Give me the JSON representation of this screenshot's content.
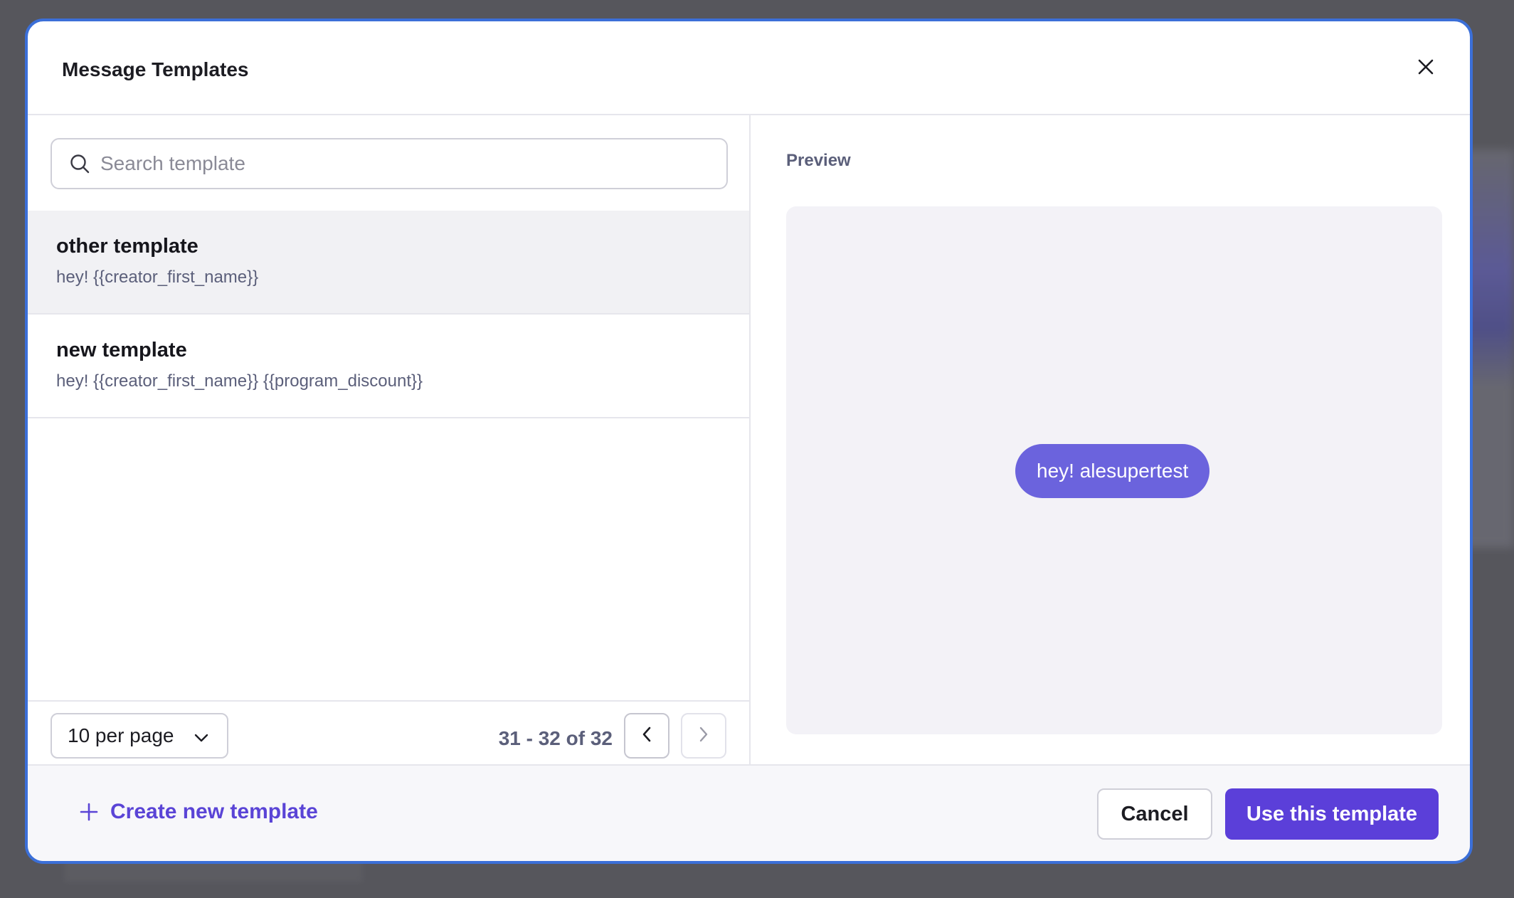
{
  "modal": {
    "title": "Message Templates",
    "close_icon": "close-icon"
  },
  "search": {
    "placeholder": "Search template",
    "value": "",
    "icon": "search-icon"
  },
  "templates": [
    {
      "name": "other template",
      "body": "hey! {{creator_first_name}}",
      "selected": true
    },
    {
      "name": "new template",
      "body": "hey! {{creator_first_name}} {{program_discount}}",
      "selected": false
    }
  ],
  "pagination": {
    "per_page_label": "10 per page",
    "range_label": "31 - 32 of 32",
    "prev_icon": "chevron-left-icon",
    "next_icon": "chevron-right-icon"
  },
  "preview": {
    "label": "Preview",
    "message": "hey! alesupertest"
  },
  "footer": {
    "create_label": "Create new template",
    "cancel_label": "Cancel",
    "use_label": "Use this template"
  },
  "colors": {
    "accent": "#5b3fd9",
    "bubble": "#6b63dd",
    "link": "#5a44d6",
    "modal_border": "#3b6fd8"
  }
}
